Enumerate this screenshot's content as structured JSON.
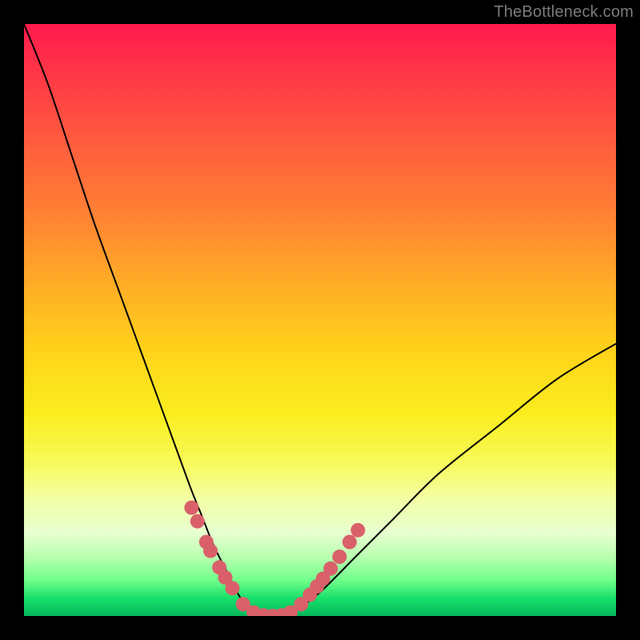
{
  "watermark": "TheBottleneck.com",
  "chart_data": {
    "type": "line",
    "title": "",
    "xlabel": "",
    "ylabel": "",
    "xlim": [
      0,
      100
    ],
    "ylim": [
      0,
      100
    ],
    "series": [
      {
        "name": "bottleneck-curve",
        "x": [
          0,
          4,
          8,
          12,
          16,
          20,
          24,
          28,
          30,
          32,
          34,
          36,
          38,
          40,
          42,
          44,
          46,
          50,
          56,
          62,
          70,
          80,
          90,
          100
        ],
        "values": [
          100,
          90,
          78,
          66,
          55,
          44,
          33,
          22,
          17,
          12,
          8,
          4,
          1,
          0,
          0,
          0,
          1,
          4,
          10,
          16,
          24,
          32,
          40,
          46
        ]
      }
    ],
    "markers": {
      "name": "highlight-dots",
      "color": "#d9606a",
      "x": [
        28.3,
        29.3,
        30.8,
        31.5,
        33.0,
        34.0,
        35.2,
        37.0,
        38.8,
        40.5,
        42.0,
        43.5,
        45.0,
        46.8,
        48.3,
        49.5,
        50.5,
        51.8,
        53.3,
        55.0,
        56.4
      ],
      "values": [
        18.3,
        16.0,
        12.5,
        11.0,
        8.2,
        6.5,
        4.7,
        2.0,
        0.6,
        0.1,
        0.0,
        0.1,
        0.6,
        2.0,
        3.6,
        5.0,
        6.3,
        8.0,
        10.0,
        12.5,
        14.5
      ]
    }
  }
}
